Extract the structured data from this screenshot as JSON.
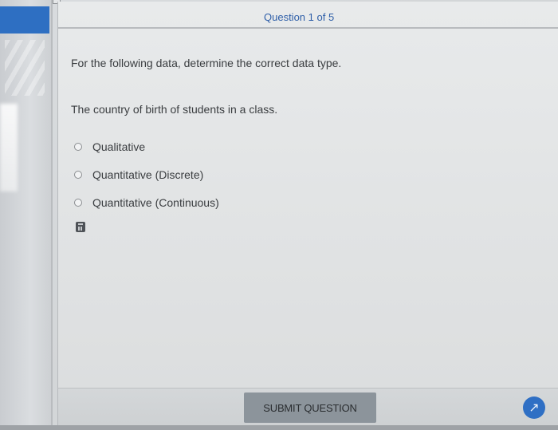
{
  "header": {
    "question_counter": "Question 1 of 5"
  },
  "question": {
    "instruction": "For the following data, determine the correct data type.",
    "text": "The country of birth of students in a class.",
    "options": [
      {
        "label": "Qualitative"
      },
      {
        "label": "Quantitative (Discrete)"
      },
      {
        "label": "Quantitative (Continuous)"
      }
    ]
  },
  "footer": {
    "submit_label": "SUBMIT QUESTION",
    "next_icon": "↗"
  },
  "colors": {
    "accent": "#2f6fc4",
    "counter_text": "#2f5fa8",
    "submit_bg": "#8c949b"
  },
  "icons": {
    "calculator": "calculator-icon",
    "next": "next-arrow-icon"
  }
}
